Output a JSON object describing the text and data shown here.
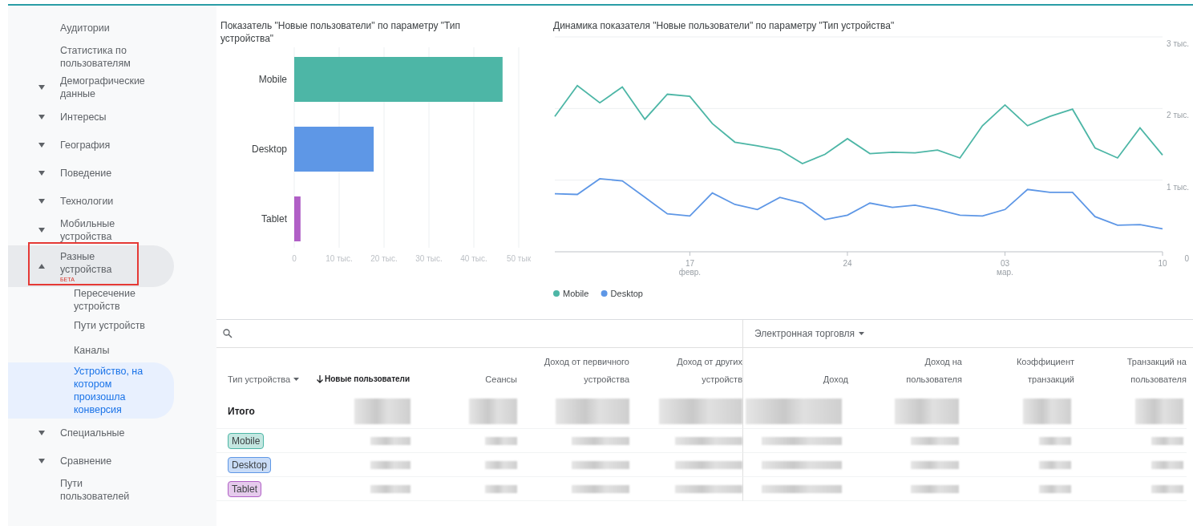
{
  "sidebar": {
    "items": [
      {
        "label": "Аудитории",
        "kind": "link",
        "selected": false
      },
      {
        "label": "Статистика по пользователям",
        "kind": "link",
        "selected": false
      },
      {
        "label": "Демографические данные",
        "kind": "group",
        "expanded": false,
        "selected": false
      },
      {
        "label": "Интересы",
        "kind": "group",
        "expanded": false,
        "selected": false
      },
      {
        "label": "География",
        "kind": "group",
        "expanded": false,
        "selected": false
      },
      {
        "label": "Поведение",
        "kind": "group",
        "expanded": false,
        "selected": false
      },
      {
        "label": "Технологии",
        "kind": "group",
        "expanded": false,
        "selected": false
      },
      {
        "label": "Мобильные устройства",
        "kind": "group",
        "expanded": false,
        "selected": false
      },
      {
        "label": "Разные устройства",
        "kind": "group",
        "expanded": true,
        "selected": true,
        "badge": "БЕТА",
        "annotated": true,
        "children": [
          {
            "label": "Пересечение устройств",
            "selected": false
          },
          {
            "label": "Пути устройств",
            "selected": false
          },
          {
            "label": "Каналы",
            "selected": false
          },
          {
            "label": "Устройство, на котором произошла конверсия",
            "selected": true
          }
        ]
      },
      {
        "label": "Специальные",
        "kind": "group",
        "expanded": false,
        "selected": false
      },
      {
        "label": "Сравнение",
        "kind": "group",
        "expanded": false,
        "selected": false
      },
      {
        "label": "Пути пользователей",
        "kind": "link",
        "selected": false
      }
    ]
  },
  "bar_chart": {
    "chart_data": {
      "type": "bar",
      "orientation": "horizontal",
      "title": "Показатель \"Новые пользователи\" по параметру \"Тип устройства\"",
      "categories": [
        "Mobile",
        "Desktop",
        "Tablet"
      ],
      "values": [
        46.4,
        17.7,
        1.4
      ],
      "colors": [
        "#4db6a6",
        "#5e97e6",
        "#b05fc6"
      ],
      "xlim": [
        0,
        50
      ],
      "grid": true,
      "xticks": [
        0,
        {
          "value": 10,
          "label": "10 тыс."
        },
        {
          "value": 20,
          "label": "20 тыс."
        },
        {
          "value": 30,
          "label": "30 тыс."
        },
        {
          "value": 40,
          "label": "40 тыс."
        },
        {
          "value": 50,
          "label": "50 тык"
        }
      ]
    }
  },
  "line_chart": {
    "chart_data": {
      "type": "line",
      "title": "Динамика показателя \"Новые пользователи\" по параметру \"Тип устройства\"",
      "categories": [
        null,
        null,
        null,
        null,
        null,
        null,
        "17 февр.",
        null,
        null,
        null,
        null,
        null,
        null,
        "24",
        null,
        null,
        null,
        null,
        null,
        null,
        "03 мар.",
        null,
        null,
        null,
        null,
        null,
        null,
        "10"
      ],
      "ylim": [
        0,
        3
      ],
      "grid": true,
      "legend": "bottom",
      "yticks": [
        0,
        {
          "value": 1,
          "label": "1 тыс."
        },
        {
          "value": 2,
          "label": "2 тыс."
        },
        {
          "value": 3,
          "label": "3 тыс."
        }
      ],
      "series": [
        {
          "name": "Mobile",
          "color": "#4db6a6",
          "values": [
            1.89,
            2.32,
            2.08,
            2.3,
            1.85,
            2.2,
            2.17,
            1.79,
            1.53,
            1.48,
            1.42,
            1.23,
            1.36,
            1.58,
            1.37,
            1.39,
            1.38,
            1.42,
            1.31,
            1.76,
            2.05,
            1.76,
            1.89,
            1.99,
            1.45,
            1.31,
            1.73,
            1.35
          ]
        },
        {
          "name": "Desktop",
          "color": "#5e97e6",
          "values": [
            0.81,
            0.8,
            1.02,
            0.99,
            0.76,
            0.53,
            0.5,
            0.82,
            0.66,
            0.59,
            0.76,
            0.68,
            0.45,
            0.51,
            0.68,
            0.62,
            0.65,
            0.59,
            0.51,
            0.5,
            0.59,
            0.87,
            0.83,
            0.83,
            0.49,
            0.37,
            0.38,
            0.32
          ]
        }
      ]
    }
  },
  "table": {
    "metric_group": {
      "label": "Электронная торговля"
    },
    "columns": [
      {
        "label": "Тип устройства",
        "kind": "dimension",
        "sorted": false
      },
      {
        "label": "Новые пользователи",
        "kind": "metric",
        "sorted": true
      },
      {
        "label": "Сеансы",
        "kind": "metric",
        "sorted": false
      },
      {
        "label": "Доход от первичного устройства",
        "kind": "metric",
        "sorted": false
      },
      {
        "label": "Доход от других устройств",
        "kind": "metric",
        "sorted": false
      },
      {
        "label": "Доход",
        "kind": "metric",
        "sorted": false
      },
      {
        "label": "Доход на пользователя",
        "kind": "metric",
        "sorted": false
      },
      {
        "label": "Коэффициент транзакций",
        "kind": "metric",
        "sorted": false
      },
      {
        "label": "Транзакций на пользователя",
        "kind": "metric",
        "sorted": false
      }
    ],
    "rows": [
      {
        "label": "Итого",
        "kind": "total"
      },
      {
        "label": "Mobile",
        "kind": "chip",
        "color": "#4db6a6"
      },
      {
        "label": "Desktop",
        "kind": "chip",
        "color": "#5e97e6"
      },
      {
        "label": "Tablet",
        "kind": "chip",
        "color": "#b05fc6"
      }
    ]
  }
}
